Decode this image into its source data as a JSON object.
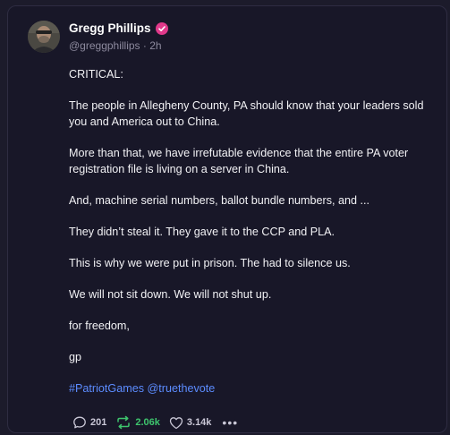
{
  "post": {
    "author_name": "Gregg Phillips",
    "handle": "@greggphillips",
    "separator": " · ",
    "time": "2h",
    "paragraphs": [
      "CRITICAL:",
      "The people in Allegheny County, PA should know that your leaders sold you and America out to China.",
      "More than that, we have irrefutable evidence that the entire PA voter registration file is living on a server in China.",
      "And, machine serial numbers, ballot bundle numbers, and ...",
      "They didn’t steal it. They gave it to the CCP and PLA.",
      "This is why we were put in prison. The had to silence us.",
      "We will not sit down. We will not shut up.",
      "for freedom,",
      "gp"
    ],
    "hashtag": "#PatriotGames",
    "mention": "@truethevote"
  },
  "actions": {
    "reply_count": "201",
    "repost_count": "2.06k",
    "like_count": "3.14k",
    "more_label": "•••"
  },
  "colors": {
    "background": "#181728",
    "verified_badge": "#e0398a",
    "link": "#5c8cff",
    "repost_active": "#3ec46d"
  },
  "icons": [
    "avatar",
    "verified-badge-icon",
    "reply-icon",
    "repost-icon",
    "like-icon",
    "more-icon"
  ]
}
